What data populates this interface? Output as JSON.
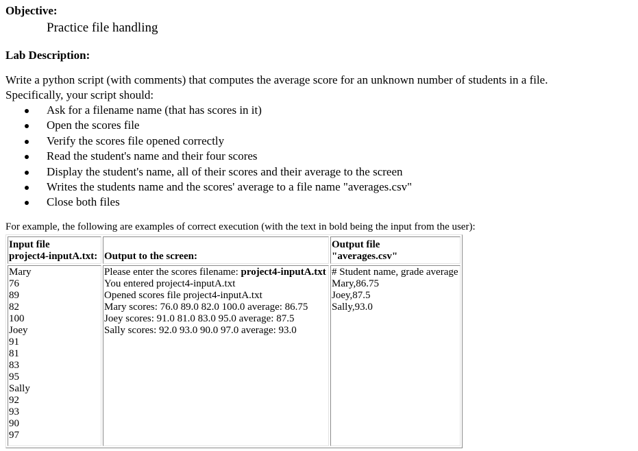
{
  "objective": {
    "heading": "Objective:",
    "text": "Practice file handling"
  },
  "lab_description": {
    "heading": "Lab Description:",
    "intro": "Write a python script (with comments) that computes the average score for an unknown number of students in a file. Specifically, your script should:",
    "steps": [
      "Ask for a filename name (that has scores in it)",
      "Open the scores file",
      "Verify the scores file opened correctly",
      "Read the student's name and their four scores",
      "Display the student's name, all of their scores and their average to the screen",
      "Writes the students name and the scores' average to a file name \"averages.csv\"",
      "Close both files"
    ]
  },
  "example": {
    "intro": "For example, the following are examples of correct execution (with the text in bold being the input from the user):",
    "headers": {
      "input_line1": "Input file",
      "input_line2": "project4-inputA.txt:",
      "screen": "Output to the screen:",
      "output_line1": "Output file",
      "output_line2": "\"averages.csv\""
    },
    "input_file_lines": [
      "Mary",
      "76",
      "89",
      "82",
      "100",
      "Joey",
      "91",
      "81",
      "83",
      "95",
      "Sally",
      "92",
      "93",
      "90",
      "97"
    ],
    "screen_prompt": "Please enter the scores filename: ",
    "screen_prompt_input": "project4-inputA.txt",
    "screen_lines": [
      "You entered project4-inputA.txt",
      "Opened scores file project4-inputA.txt",
      "Mary scores: 76.0 89.0 82.0 100.0 average: 86.75",
      "Joey scores: 91.0 81.0 83.0 95.0 average: 87.5",
      "Sally scores: 92.0 93.0 90.0 97.0 average: 93.0"
    ],
    "output_file_lines": [
      "# Student name, grade average",
      "Mary,86.75",
      "Joey,87.5",
      "Sally,93.0"
    ]
  }
}
